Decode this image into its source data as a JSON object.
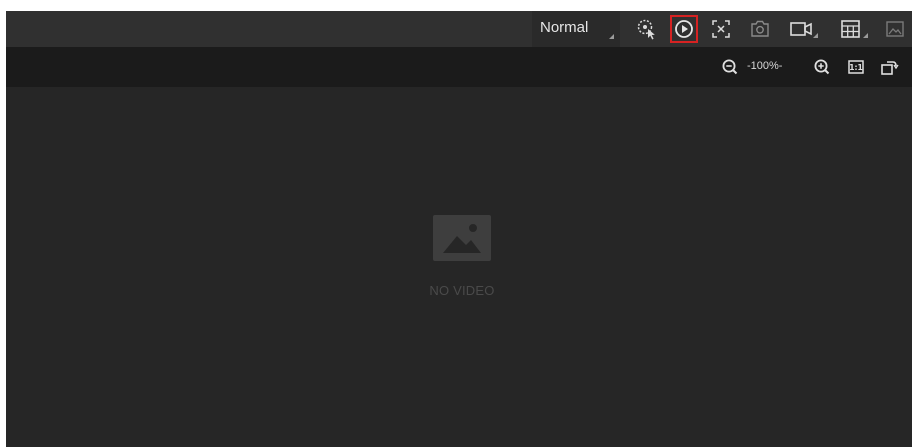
{
  "toolbar": {
    "mode": "Normal",
    "buttons": [
      {
        "icon": "smart-search-icon"
      },
      {
        "icon": "play-circle-icon",
        "highlighted": true
      },
      {
        "icon": "fullscreen-icon"
      },
      {
        "icon": "camera-icon"
      },
      {
        "icon": "video-record-icon",
        "has_dropdown": true
      },
      {
        "icon": "grid-layout-icon",
        "has_dropdown": true
      },
      {
        "icon": "image-icon"
      }
    ]
  },
  "zoombar": {
    "zoom_level": "-100%-",
    "buttons": [
      {
        "icon": "zoom-out-icon"
      },
      {
        "icon": "zoom-in-icon"
      },
      {
        "icon": "actual-size-icon",
        "label": "1:1"
      },
      {
        "icon": "rotate-icon"
      }
    ]
  },
  "video": {
    "status": "NO VIDEO"
  },
  "colors": {
    "toolbar_bg": "#303030",
    "zoombar_bg": "#1b1b1b",
    "video_bg": "#262626",
    "highlight": "#d62222",
    "icon": "#dcdcdc"
  }
}
